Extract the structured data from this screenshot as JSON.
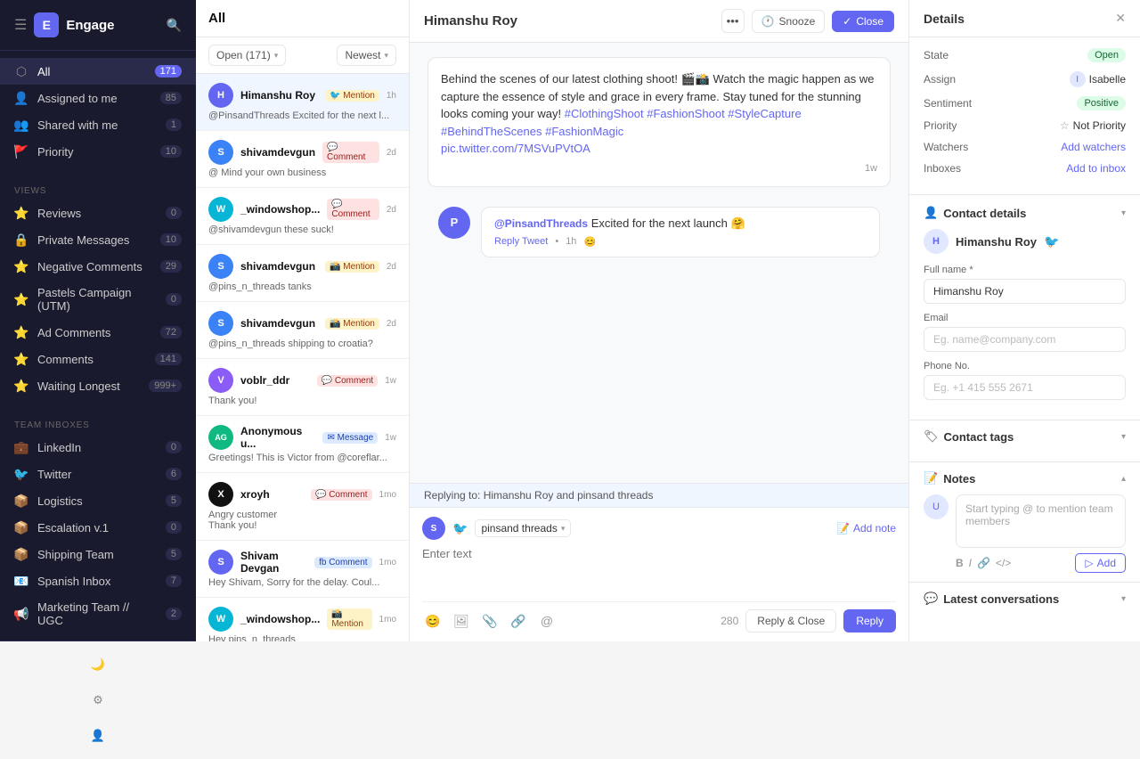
{
  "app": {
    "name": "Engage",
    "logo_letter": "E"
  },
  "left_nav": {
    "top_icons": [
      "☰",
      "🔍"
    ],
    "views_title": "VIEWS",
    "items": [
      {
        "id": "all",
        "label": "All",
        "count": "171",
        "icon": "⬡",
        "active": true
      },
      {
        "id": "assigned",
        "label": "Assigned to me",
        "count": "85",
        "icon": "👤"
      },
      {
        "id": "shared",
        "label": "Shared with me",
        "count": "1",
        "icon": "👥"
      },
      {
        "id": "priority",
        "label": "Priority",
        "count": "10",
        "icon": "🚩"
      }
    ],
    "views": [
      {
        "id": "reviews",
        "label": "Reviews",
        "count": "0",
        "icon": "⭐"
      },
      {
        "id": "private",
        "label": "Private Messages",
        "count": "10",
        "icon": "🔒"
      },
      {
        "id": "negative",
        "label": "Negative Comments",
        "count": "29",
        "icon": "⭐"
      },
      {
        "id": "pastels",
        "label": "Pastels Campaign (UTM)",
        "count": "0",
        "icon": "⭐"
      },
      {
        "id": "adcomments",
        "label": "Ad Comments",
        "count": "72",
        "icon": "⭐"
      },
      {
        "id": "comments",
        "label": "Comments",
        "count": "141",
        "icon": "⭐"
      },
      {
        "id": "waiting",
        "label": "Waiting Longest",
        "count": "999+",
        "icon": "⭐"
      }
    ],
    "team_inboxes_title": "TEAM INBOXES",
    "team_inboxes": [
      {
        "id": "linkedin",
        "label": "LinkedIn",
        "count": "0",
        "icon": "💼"
      },
      {
        "id": "twitter",
        "label": "Twitter",
        "count": "6",
        "icon": "🐦"
      },
      {
        "id": "logistics",
        "label": "Logistics",
        "count": "5",
        "icon": "📦"
      },
      {
        "id": "escalation",
        "label": "Escalation v.1",
        "count": "0",
        "icon": "📦"
      },
      {
        "id": "shipping",
        "label": "Shipping Team",
        "count": "5",
        "icon": "📦"
      },
      {
        "id": "spanish",
        "label": "Spanish Inbox",
        "count": "7",
        "icon": "📧"
      },
      {
        "id": "marketing",
        "label": "Marketing Team // UGC",
        "count": "2",
        "icon": "📢"
      }
    ],
    "bottom_icons": [
      "🌙",
      "⚙",
      "👤"
    ]
  },
  "middle_panel": {
    "title": "All",
    "filter_open": "Open (171)",
    "filter_newest": "Newest",
    "conversations": [
      {
        "id": "himanshu",
        "name": "Himanshu Roy",
        "badge_type": "mention",
        "badge_label": "Mention",
        "platform": "twitter",
        "time": "1h",
        "preview": "@PinsandThreads Excited for the next l...",
        "avatar_color": "#6366f1",
        "avatar_letter": "H",
        "active": true
      },
      {
        "id": "shivam1",
        "name": "shivamdevgun",
        "badge_type": "comment",
        "badge_label": "Comment",
        "platform": "instagram",
        "time": "2d",
        "preview": "@ Mind your own business",
        "avatar_color": "#3b82f6",
        "avatar_letter": "S"
      },
      {
        "id": "windowshop1",
        "name": "_windowshop...",
        "badge_type": "comment",
        "badge_label": "Comment",
        "platform": "instagram",
        "time": "2d",
        "preview": "@shivamdevgun these suck!",
        "avatar_color": "#06b6d4",
        "avatar_letter": "W"
      },
      {
        "id": "shivam2",
        "name": "shivamdevgun",
        "badge_type": "mention",
        "badge_label": "Mention",
        "platform": "instagram",
        "time": "2d",
        "preview": "@pins_n_threads tanks",
        "avatar_color": "#3b82f6",
        "avatar_letter": "S"
      },
      {
        "id": "shivam3",
        "name": "shivamdevgun",
        "badge_type": "mention",
        "badge_label": "Mention",
        "platform": "instagram",
        "time": "2d",
        "preview": "@pins_n_threads shipping to croatia?",
        "avatar_color": "#3b82f6",
        "avatar_letter": "S"
      },
      {
        "id": "voblr",
        "name": "voblr_ddr",
        "badge_type": "comment",
        "badge_label": "Comment",
        "platform": "instagram",
        "time": "1w",
        "preview": "Thank you!",
        "avatar_color": "#8b5cf6",
        "avatar_letter": "V"
      },
      {
        "id": "anonymous",
        "name": "Anonymous u...",
        "badge_type": "message",
        "badge_label": "Message",
        "platform": "instagram",
        "time": "1w",
        "preview": "Greetings! This is Victor from @coreflar...",
        "avatar_color": "#10b981",
        "avatar_letter": "AG"
      },
      {
        "id": "xroyh",
        "name": "xroyh",
        "badge_type": "comment",
        "badge_label": "Comment",
        "platform": "instagram",
        "time": "1mo",
        "preview": "Angry customer",
        "second_line": "Thank you!",
        "avatar_color": "#111",
        "avatar_letter": "X"
      },
      {
        "id": "shivamdevgan",
        "name": "Shivam Devgan",
        "badge_type": "comment",
        "badge_label": "Comment",
        "platform": "facebook",
        "time": "1mo",
        "preview": "Hey Shivam, Sorry for the delay. Coul...",
        "avatar_color": "#6366f1",
        "avatar_letter": "S"
      },
      {
        "id": "windowshop2",
        "name": "_windowshop...",
        "badge_type": "mention",
        "badge_label": "Mention",
        "platform": "instagram",
        "time": "1mo",
        "preview": "Hey pins_n_threads",
        "avatar_color": "#06b6d4",
        "avatar_letter": "W"
      }
    ]
  },
  "chat": {
    "contact_name": "Himanshu Roy",
    "btn_more": "•••",
    "btn_snooze": "Snooze",
    "btn_close": "Close",
    "tweet": {
      "text": "Behind the scenes of our latest clothing shoot! 🎬📸 Watch the magic happen as we capture the essence of style and grace in every frame. Stay tuned for the stunning looks coming your way! #ClothingShoot #FashionShoot #StyleCapture #BehindTheScenes #FashionMagic",
      "link": "pic.twitter.com/7MSVuPVtOA",
      "time": "1w"
    },
    "reply": {
      "username": "@PinsandThreads",
      "text": "Excited for the next launch 🤗",
      "action_reply": "Reply Tweet",
      "action_time": "1h",
      "action_emoji": "😊"
    },
    "replying_to": "Replying to: Himanshu Roy and pinsand threads",
    "reply_account": "pinsand threads",
    "placeholder": "Enter text",
    "char_count": "280",
    "btn_reply_close": "Reply & Close",
    "btn_reply": "Reply",
    "add_note_label": "Add note"
  },
  "right_panel": {
    "title": "Details",
    "state_label": "State",
    "state_value": "Open",
    "assign_label": "Assign",
    "assign_value": "Isabelle",
    "sentiment_label": "Sentiment",
    "sentiment_value": "Positive",
    "priority_label": "Priority",
    "priority_value": "Not Priority",
    "watchers_label": "Watchers",
    "watchers_value": "Add watchers",
    "inboxes_label": "Inboxes",
    "inboxes_value": "Add to inbox",
    "contact_details_title": "Contact details",
    "contact_name": "Himanshu Roy",
    "full_name_label": "Full name *",
    "full_name_value": "Himanshu Roy",
    "email_label": "Email",
    "email_placeholder": "Eg. name@company.com",
    "phone_label": "Phone No.",
    "phone_placeholder": "Eg. +1 415 555 2671",
    "contact_tags_title": "Contact tags",
    "notes_title": "Notes",
    "notes_placeholder": "Start typing @ to mention team members",
    "notes_add_btn": "Add",
    "latest_conv_title": "Latest conversations"
  }
}
